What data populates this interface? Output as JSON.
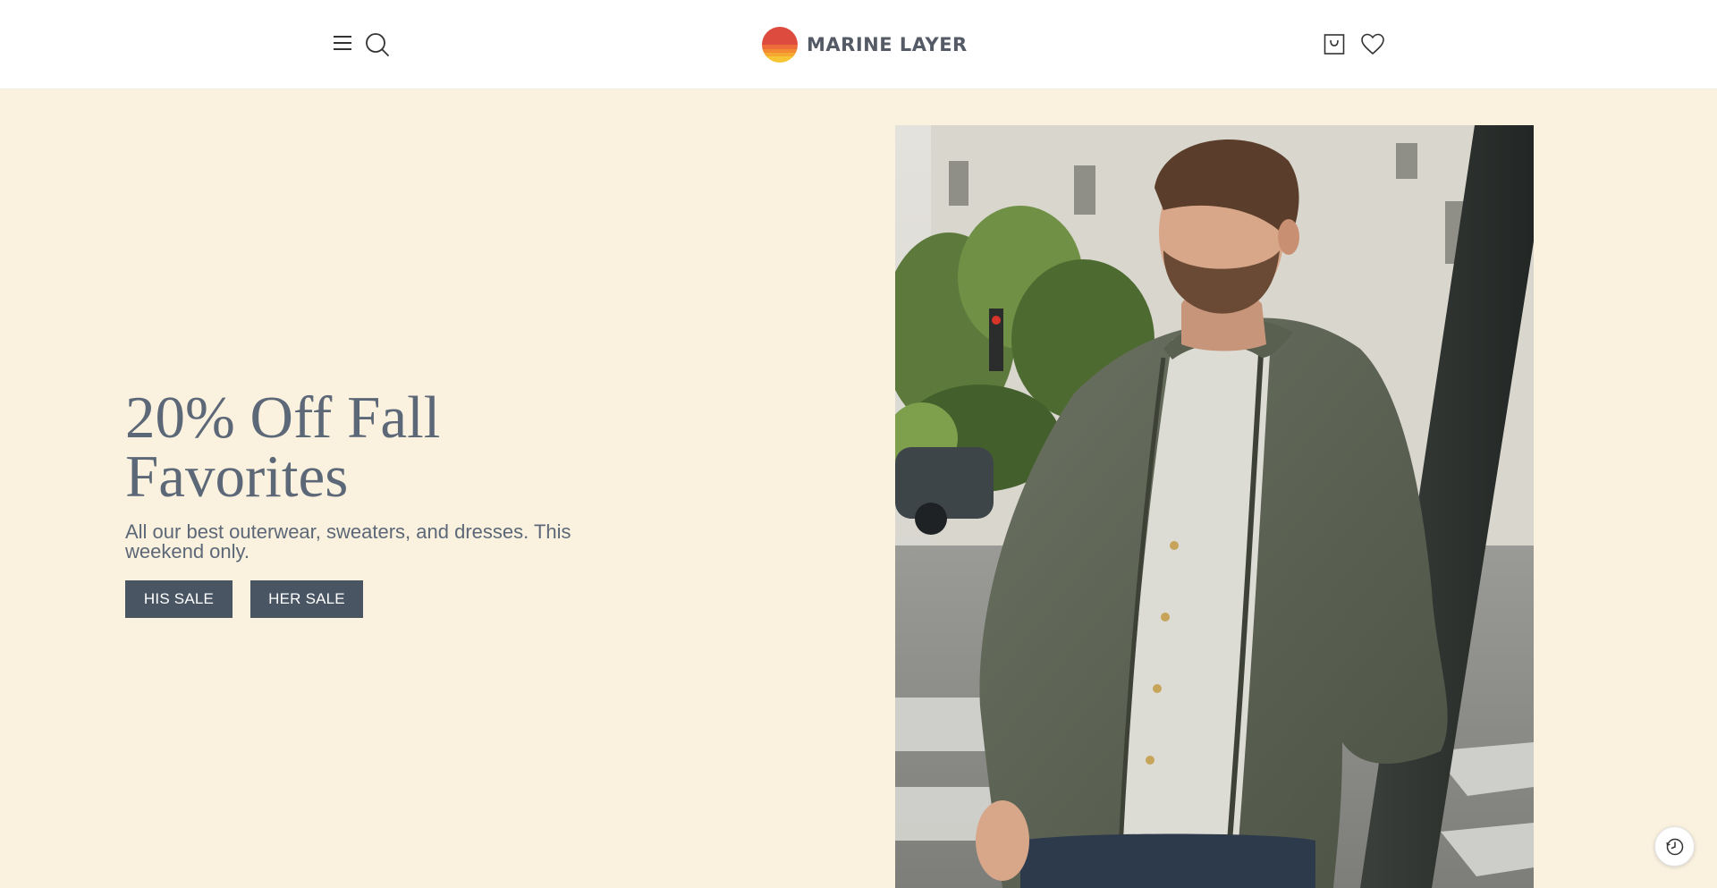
{
  "header": {
    "brand": "MARINE LAYER",
    "menu_icon": "hamburger-menu-icon",
    "search_icon": "search-icon",
    "cart_icon": "shopping-bag-icon",
    "wishlist_icon": "heart-icon"
  },
  "hero": {
    "title": "20% Off Fall Favorites",
    "subtitle": "All our best outerwear, sweaters, and dresses. This weekend only.",
    "buttons": [
      {
        "label": "HIS SALE"
      },
      {
        "label": "HER SALE"
      }
    ],
    "image": "man-in-olive-bomber-jacket-photo"
  },
  "floating": {
    "history_icon": "clock-history-icon"
  },
  "colors": {
    "hero_background": "#faf1df",
    "button_background": "#4a5563",
    "heading_text": "#5c6877",
    "logo_red": "#dd4b3f",
    "logo_orange": "#f28a32",
    "logo_yellow": "#f7c435"
  }
}
